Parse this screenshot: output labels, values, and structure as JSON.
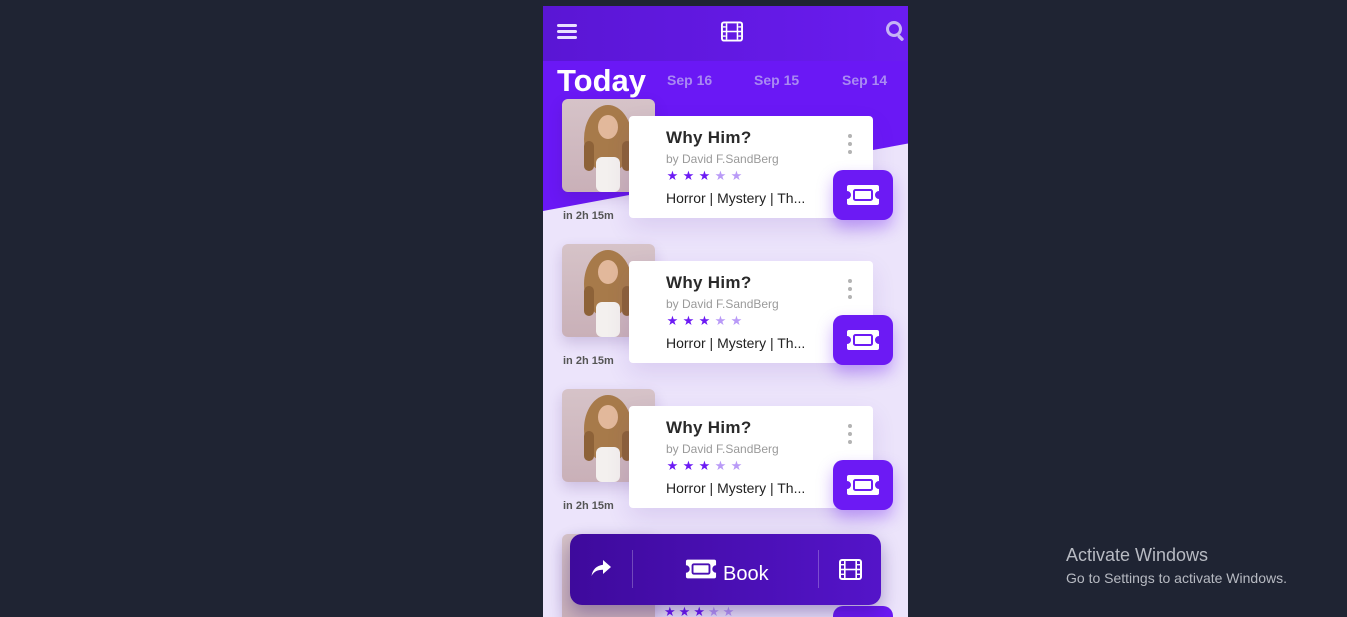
{
  "header": {
    "menu_icon": "hamburger-menu-icon",
    "logo_icon": "film-icon",
    "search_icon": "search-icon"
  },
  "dates": {
    "today": "Today",
    "tabs": [
      "Sep 16",
      "Sep 15",
      "Sep 14"
    ]
  },
  "movies": [
    {
      "title": "Why Him?",
      "author": "by David F.SandBerg",
      "rating": 3,
      "max_rating": 5,
      "genre": "Horror | Mystery | Th...",
      "time": "in 2h 15m"
    },
    {
      "title": "Why Him?",
      "author": "by David F.SandBerg",
      "rating": 3,
      "max_rating": 5,
      "genre": "Horror | Mystery | Th...",
      "time": "in 2h 15m"
    },
    {
      "title": "Why Him?",
      "author": "by David F.SandBerg",
      "rating": 3,
      "max_rating": 5,
      "genre": "Horror | Mystery | Th...",
      "time": "in 2h 15m"
    }
  ],
  "bottom_bar": {
    "share_icon": "share-icon",
    "book_icon": "ticket-icon",
    "book_label": "Book",
    "film_icon": "film-icon"
  },
  "colors": {
    "accent": "#6c1af4",
    "header": "#5a16d4",
    "star_filled": "#6c1af4",
    "star_empty": "#b99af7"
  },
  "watermark": {
    "line1": "Activate Windows",
    "line2": "Go to Settings to activate Windows."
  }
}
